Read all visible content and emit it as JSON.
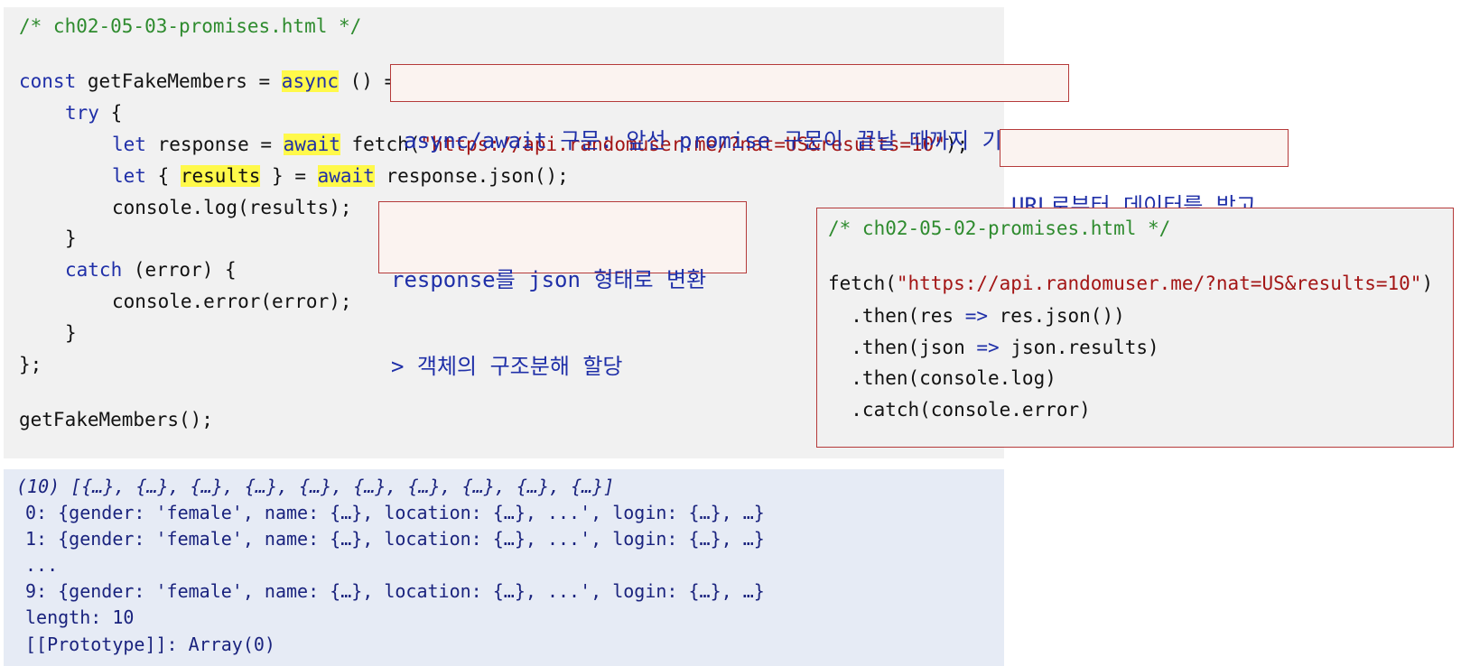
{
  "code": {
    "comment": "/* ch02-05-03-promises.html */",
    "l1_const": "const",
    "l1_name": " getFakeMembers = ",
    "l1_async": "async",
    "l1_tail": " () =",
    "l2_try": "try",
    "l2_tail": " {",
    "l3_let": "let",
    "l3_mid": " response = ",
    "l3_await": "await",
    "l3_fetch": " fetch(",
    "l3_url": "\"https://api.randomuser.me/?nat=US&results=10\"",
    "l3_end": ");",
    "l4_let": "let",
    "l4_open": " { ",
    "l4_results": "results",
    "l4_mid": " } = ",
    "l4_await": "await",
    "l4_tail": " response.json();",
    "l5": "console.log(results);",
    "l6": "}",
    "l7_catch": "catch",
    "l7_tail": " (error) {",
    "l8": "console.error(error);",
    "l9": "}",
    "l10": "};",
    "l11": "getFakeMembers();"
  },
  "callouts": {
    "async_note": "async/await 구문: 앞선 promise 구문이 끝날 때까지 기다림",
    "fetch_note": "URL로부터 데이터를 받고",
    "json_note_1": "response를 json 형태로 변환",
    "json_note_2": "> 객체의 구조분해 할당"
  },
  "reference": {
    "comment": "/* ch02-05-02-promises.html */",
    "fetch_open": "fetch(",
    "url": "\"https://api.randomuser.me/?nat=US&results=10\"",
    "fetch_close": ")",
    "then1_a": "  .then(res ",
    "arrow": "=>",
    "then1_b": " res.json())",
    "then2_a": "  .then(json ",
    "then2_b": " json.results)",
    "then3": "  .then(console.log)",
    "catch": "  .catch(console.error)"
  },
  "console": {
    "summary": "(10) [{…}, {…}, {…}, {…}, {…}, {…}, {…}, {…}, {…}, {…}]",
    "row0": "0: {gender: 'female', name: {…}, location: {…}, ...', login: {…}, …}",
    "row1": "1: {gender: 'female', name: {…}, location: {…}, ...', login: {…}, …}",
    "ellipsis": "...",
    "row9": "9: {gender: 'female', name: {…}, location: {…}, ...', login: {…}, …}",
    "length": "length: 10",
    "prototype": "[[Prototype]]: Array(0)"
  }
}
